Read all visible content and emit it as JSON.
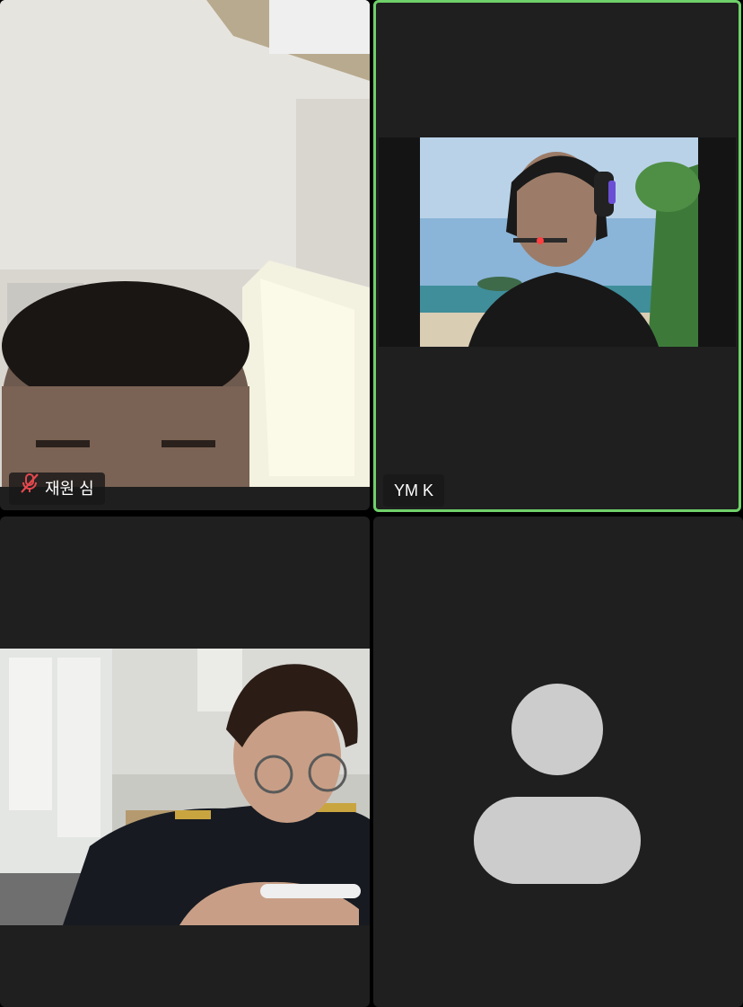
{
  "participants": [
    {
      "name": "재원 심",
      "muted": true,
      "video": "on",
      "active_speaker": false
    },
    {
      "name": "YM K",
      "muted": false,
      "video": "on",
      "active_speaker": true
    },
    {
      "name": "",
      "muted": false,
      "video": "on",
      "active_speaker": false
    },
    {
      "name": "",
      "muted": false,
      "video": "off",
      "active_speaker": false
    }
  ],
  "colors": {
    "tile_background": "#1f1f1f",
    "active_speaker_border": "#6fd16a",
    "muted_icon": "#e5484d",
    "avatar_placeholder": "#cccccc"
  },
  "icons": [
    "mic-muted-icon",
    "avatar-placeholder-icon"
  ]
}
